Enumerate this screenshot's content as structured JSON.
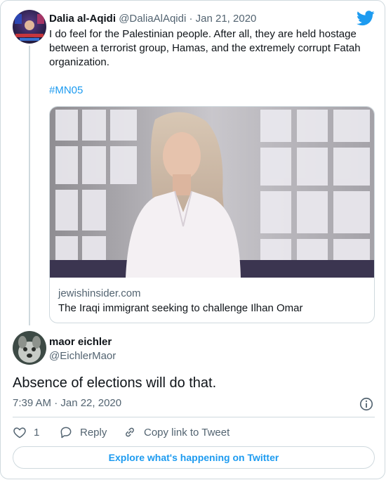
{
  "parent_tweet": {
    "author_name": "Dalia al-Aqidi",
    "handle_and_date": "@DaliaAlAqidi · Jan 21, 2020",
    "text": "I do feel for the Palestinian people. After all, they are held hostage between a terrorist group, Hamas, and the extremely corrupt Fatah organization.",
    "hashtag": "#MN05",
    "avatar_icon": "avatar-dalia",
    "link_card": {
      "domain": "jewishinsider.com",
      "title": "The Iraqi immigrant seeking to challenge Ilhan Omar",
      "image_icon": "woman-by-window-photo"
    }
  },
  "reply_tweet": {
    "author_name": "maor eichler",
    "handle": "@EichlerMaor",
    "text": "Absence of elections will do that.",
    "timestamp": "7:39 AM · Jan 22, 2020",
    "avatar_icon": "avatar-dog"
  },
  "actions": {
    "like_count": "1",
    "reply_label": "Reply",
    "copy_link_label": "Copy link to Tweet"
  },
  "explore_button_label": "Explore what's happening on Twitter",
  "colors": {
    "accent": "#1d9bf0",
    "text": "#0f1419",
    "secondary_text": "#536471",
    "border": "#cfd9de"
  }
}
